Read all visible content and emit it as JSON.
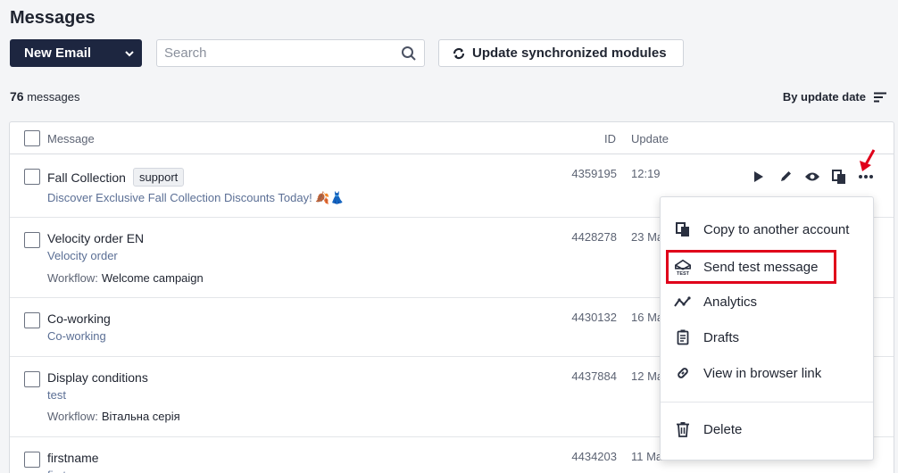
{
  "page": {
    "title": "Messages"
  },
  "toolbar": {
    "new_email_label": "New Email",
    "search_placeholder": "Search",
    "sync_label": "Update synchronized modules"
  },
  "summary": {
    "count": "76",
    "count_suffix": "messages",
    "sort_label": "By update date"
  },
  "table": {
    "headers": {
      "message": "Message",
      "id": "ID",
      "update": "Update"
    },
    "rows": [
      {
        "name": "Fall Collection",
        "tag": "support",
        "subtitle": "Discover Exclusive Fall Collection Discounts Today! 🍂👗",
        "workflow_label": "",
        "workflow": "",
        "id": "4359195",
        "update": "12:19"
      },
      {
        "name": "Velocity order EN",
        "tag": "",
        "subtitle": "Velocity order",
        "workflow_label": "Workflow:",
        "workflow": "Welcome campaign",
        "id": "4428278",
        "update": "23 Ma"
      },
      {
        "name": "Co-working",
        "tag": "",
        "subtitle": "Co-working",
        "workflow_label": "",
        "workflow": "",
        "id": "4430132",
        "update": "16 Ma"
      },
      {
        "name": "Display conditions",
        "tag": "",
        "subtitle": "test",
        "workflow_label": "Workflow:",
        "workflow": "Вітальна серія",
        "id": "4437884",
        "update": "12 Ma"
      },
      {
        "name": "firstname",
        "tag": "",
        "subtitle": "first",
        "workflow_label": "",
        "workflow": "",
        "id": "4434203",
        "update": "11 Ma"
      }
    ]
  },
  "menu": {
    "items": [
      {
        "label": "Copy to another account",
        "icon": "copy-icon"
      },
      {
        "label": "Send test message",
        "icon": "test-mail-icon"
      },
      {
        "label": "Analytics",
        "icon": "analytics-icon"
      },
      {
        "label": "Drafts",
        "icon": "drafts-icon"
      },
      {
        "label": "View in browser link",
        "icon": "link-icon"
      },
      {
        "label": "Delete",
        "icon": "trash-icon"
      }
    ]
  },
  "colors": {
    "primary": "#1d2640",
    "highlight": "#e0001a",
    "link": "#5b6f95"
  }
}
